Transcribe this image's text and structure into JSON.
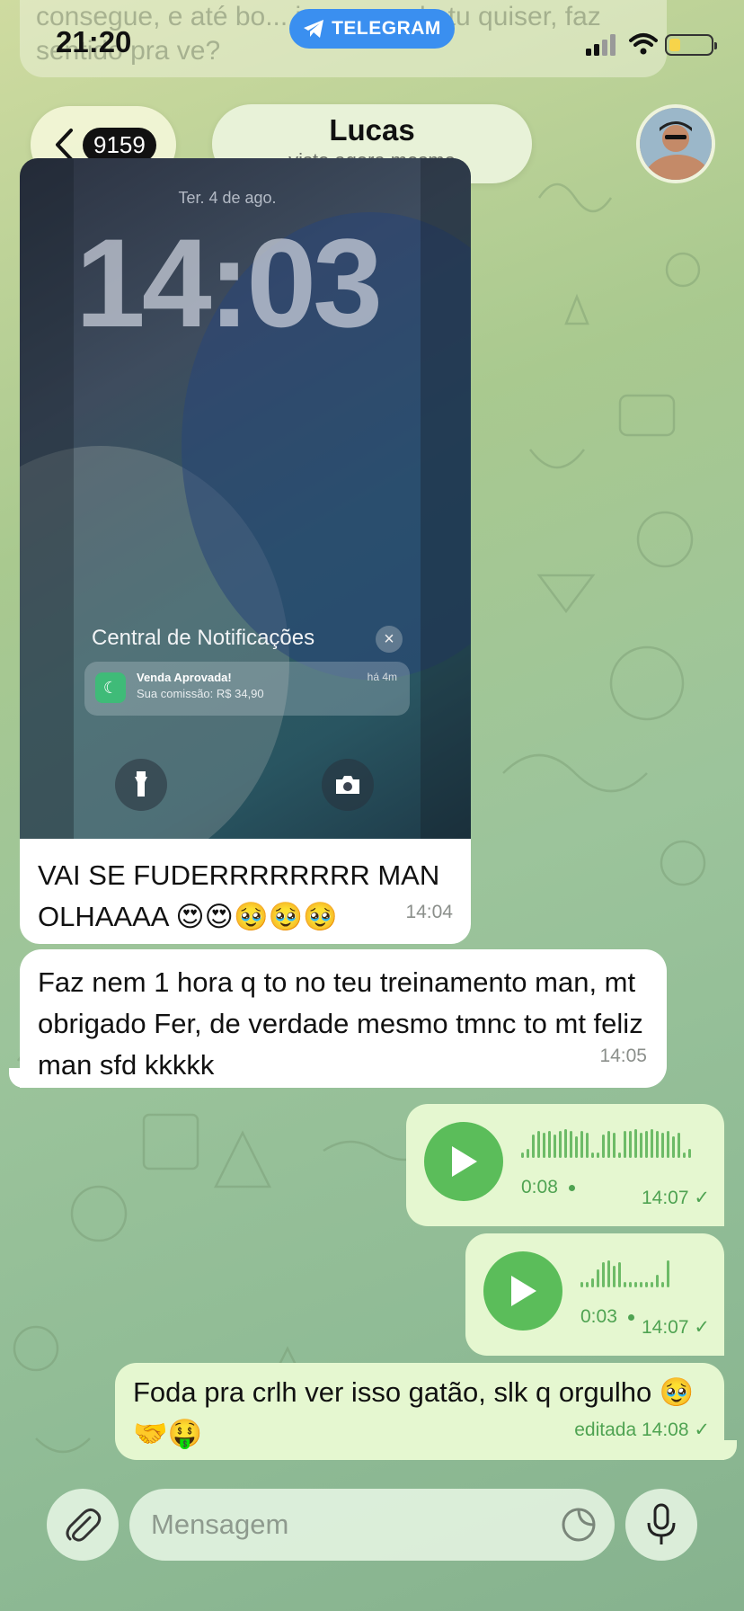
{
  "status_bar": {
    "time": "21:20",
    "telegram_label": "TELEGRAM",
    "background_text": "consegue, e até bo... isso quando tu quiser, faz sentido pra ve?"
  },
  "header": {
    "back_count": "9159",
    "contact_name": "Lucas",
    "contact_status": "visto agora mesmo"
  },
  "photo": {
    "lock_date": "Ter. 4 de ago.",
    "lock_time": "14:03",
    "notification_center": "Central de Notificações",
    "notification_app": "Venda Aprovada!",
    "notification_body": "Sua comissão: R$ 34,90",
    "notification_time": "há 4m"
  },
  "messages": [
    {
      "direction": "in",
      "text": "VAI SE FUDERRRRRRRR MAN OLHAAAA 😍😍🥹🥹🥹",
      "time": "14:04"
    },
    {
      "direction": "in",
      "text": "Faz nem 1 hora q to no teu treinamento man, mt obrigado Fer, de verdade mesmo tmnc to mt feliz man sfd kkkkk",
      "time": "14:05"
    },
    {
      "direction": "out",
      "type": "voice",
      "duration": "0:08",
      "time": "14:07",
      "status": "✓"
    },
    {
      "direction": "out",
      "type": "voice",
      "duration": "0:03",
      "time": "14:07",
      "status": "✓"
    },
    {
      "direction": "out",
      "text": "Foda pra crlh ver isso gatão, slk q orgulho 🥹🤝🤑",
      "time": "editada 14:08",
      "status": "✓"
    }
  ],
  "composer": {
    "placeholder": "Mensagem"
  },
  "colors": {
    "accent_green": "#5bbd5a",
    "outgoing_bubble": "#e5f7d0",
    "telegram_blue": "#3a8ff0"
  }
}
